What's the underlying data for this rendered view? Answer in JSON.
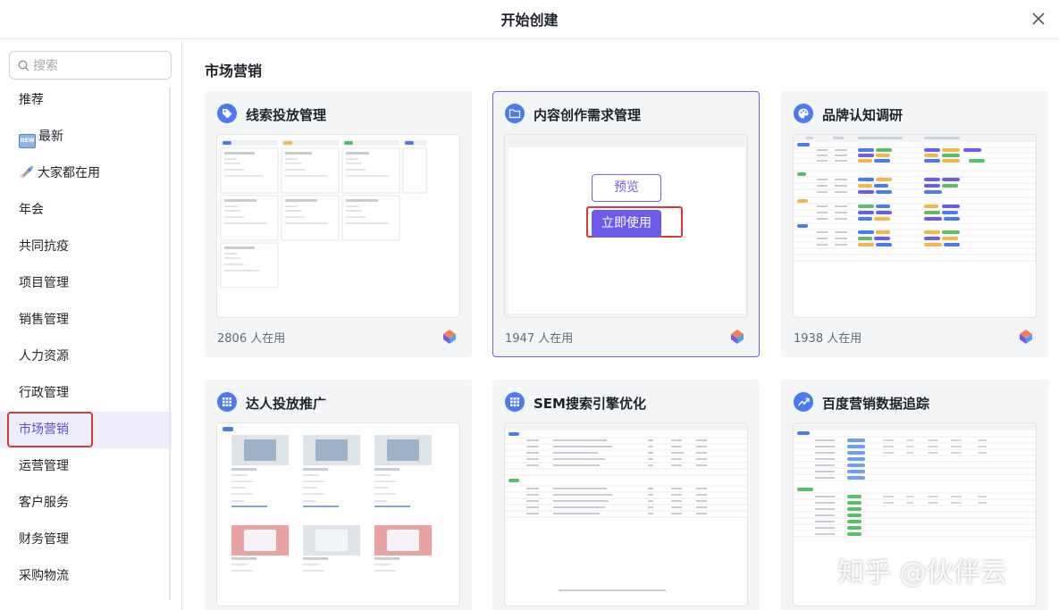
{
  "dialog": {
    "title": "开始创建"
  },
  "search": {
    "placeholder": "搜索"
  },
  "sidebar": {
    "items": [
      {
        "label": "推荐"
      },
      {
        "label": "最新",
        "badge": "NEW"
      },
      {
        "label": "大家都在用"
      },
      {
        "label": "年会"
      },
      {
        "label": "共同抗疫"
      },
      {
        "label": "项目管理"
      },
      {
        "label": "销售管理"
      },
      {
        "label": "人力资源"
      },
      {
        "label": "行政管理"
      },
      {
        "label": "市场营销"
      },
      {
        "label": "运营管理"
      },
      {
        "label": "客户服务"
      },
      {
        "label": "财务管理"
      },
      {
        "label": "采购物流"
      }
    ],
    "active": "市场营销"
  },
  "main": {
    "section_title": "市场营销",
    "cards": [
      {
        "title": "线索投放管理",
        "usage": "2806 人在用",
        "icon": "tag-icon"
      },
      {
        "title": "内容创作需求管理",
        "usage": "1947 人在用",
        "icon": "folder-icon",
        "preview_label": "预览",
        "use_label": "立即使用"
      },
      {
        "title": "品牌认知调研",
        "usage": "1938 人在用",
        "icon": "palette-icon"
      },
      {
        "title": "达人投放推广",
        "usage": "",
        "icon": "grid-icon"
      },
      {
        "title": "SEM搜索引擎优化",
        "usage": "",
        "icon": "grid-icon"
      },
      {
        "title": "百度营销数据追踪",
        "usage": "",
        "icon": "trend-icon"
      }
    ]
  },
  "watermark": "知乎 @伙伴云",
  "colors": {
    "accent": "#6d5cec",
    "highlight": "#d9363e",
    "icon_bg": "#4a7cf0"
  }
}
